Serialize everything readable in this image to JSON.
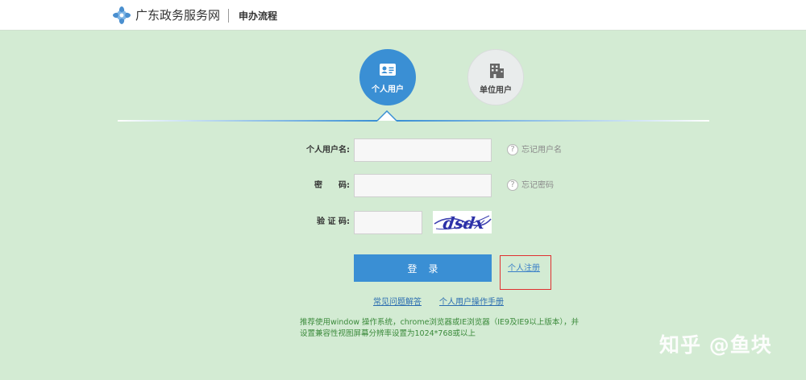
{
  "header": {
    "logo_icon": "flower-logo-icon",
    "site_name": "广东政务服务网",
    "section": "申办流程"
  },
  "tabs": [
    {
      "label": "个人用户",
      "icon": "id-card-icon",
      "active": true
    },
    {
      "label": "单位用户",
      "icon": "building-icon",
      "active": false
    }
  ],
  "form": {
    "username_label": "个人用户名:",
    "username_value": "",
    "password_label": "密　　码:",
    "password_value": "",
    "captcha_label": "验 证 码:",
    "captcha_value": "",
    "captcha_text": "dsdx",
    "forgot_username": "忘记用户名",
    "forgot_password": "忘记密码",
    "help_icon": "?",
    "login_button": "登录",
    "register_link": "个人注册"
  },
  "links": {
    "faq": "常见问题解答",
    "manual": "个人用户操作手册"
  },
  "tip": {
    "line1": "推荐使用window 操作系统，chrome浏览器或IE浏览器（IE9及IE9以上版本），并",
    "line2": "设置兼容性视图屏幕分辨率设置为1024*768或以上"
  },
  "watermark": "知乎 @鱼块",
  "colors": {
    "page_bg": "#d3ebd3",
    "accent_blue": "#3a8fd4",
    "highlight_red": "#e03030",
    "tip_green": "#3b8a3b"
  }
}
